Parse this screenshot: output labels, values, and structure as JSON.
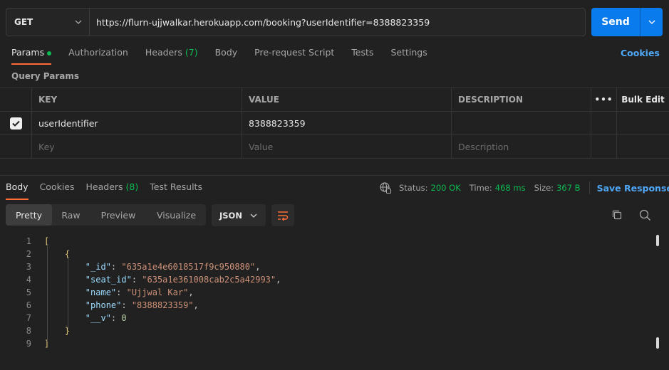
{
  "request": {
    "method": "GET",
    "url": "https://flurn-ujjwalkar.herokuapp.com/booking?userIdentifier=8388823359",
    "send_label": "Send"
  },
  "request_tabs": {
    "params": "Params",
    "authorization": "Authorization",
    "headers": "Headers",
    "headers_count": "(7)",
    "body": "Body",
    "pre_request_script": "Pre-request Script",
    "tests": "Tests",
    "settings": "Settings",
    "cookies": "Cookies"
  },
  "query_params": {
    "title": "Query Params",
    "columns": {
      "key": "KEY",
      "value": "VALUE",
      "description": "DESCRIPTION",
      "more": "•••",
      "bulk_edit": "Bulk Edit"
    },
    "rows": [
      {
        "checked": true,
        "key": "userIdentifier",
        "value": "8388823359",
        "description": ""
      }
    ],
    "placeholder": {
      "key": "Key",
      "value": "Value",
      "description": "Description"
    }
  },
  "response_tabs": {
    "body": "Body",
    "cookies": "Cookies",
    "headers": "Headers",
    "headers_count": "(8)",
    "test_results": "Test Results"
  },
  "response_status": {
    "status_label": "Status:",
    "status_value": "200 OK",
    "time_label": "Time:",
    "time_value": "468 ms",
    "size_label": "Size:",
    "size_value": "367 B",
    "save_response": "Save Response"
  },
  "view_tabs": {
    "pretty": "Pretty",
    "raw": "Raw",
    "preview": "Preview",
    "visualize": "Visualize"
  },
  "format": "JSON",
  "response_body": {
    "line_numbers": [
      "1",
      "2",
      "3",
      "4",
      "5",
      "6",
      "7",
      "8",
      "9"
    ],
    "open_array": "[",
    "open_object": "{",
    "fields": [
      {
        "key": "\"_id\"",
        "value": "\"635a1e4e6018517f9c950880\"",
        "type": "string",
        "comma": ","
      },
      {
        "key": "\"seat_id\"",
        "value": "\"635a1e361008cab2c5a42993\"",
        "type": "string",
        "comma": ","
      },
      {
        "key": "\"name\"",
        "value": "\"Ujjwal Kar\"",
        "type": "string",
        "comma": ","
      },
      {
        "key": "\"phone\"",
        "value": "\"8388823359\"",
        "type": "string",
        "comma": ","
      },
      {
        "key": "\"__v\"",
        "value": "0",
        "type": "number",
        "comma": ""
      }
    ],
    "close_object": "}",
    "close_array": "]"
  },
  "colors": {
    "accent_orange": "#ff6c37",
    "send_blue": "#097bed",
    "link_blue": "#4ea7f7",
    "success_green": "#0cbb52"
  }
}
